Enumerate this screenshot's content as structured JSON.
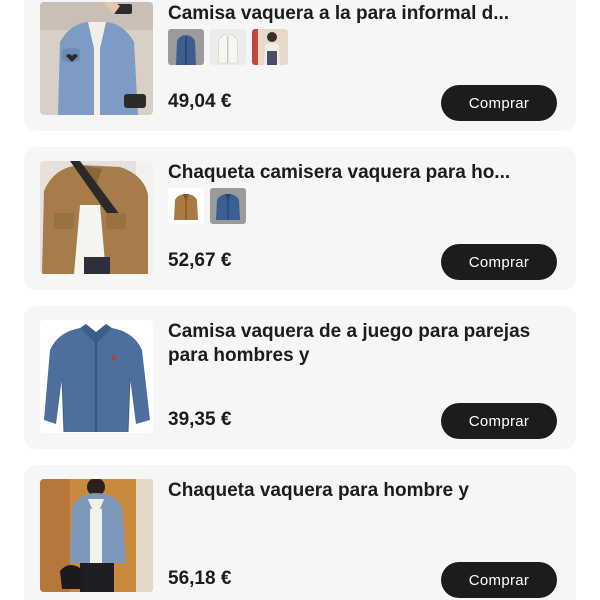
{
  "products": [
    {
      "title": "Camisa vaquera a la para informal d...",
      "price": "49,04 €",
      "button_label": "Comprar",
      "image": "denim-jacket-model-photo",
      "swatches": [
        "blue-denim-swatch",
        "white-denim-swatch",
        "person-photo-swatch"
      ]
    },
    {
      "title": "Chaqueta camisera vaquera para ho...",
      "price": "52,67 €",
      "button_label": "Comprar",
      "image": "brown-corduroy-jacket-photo",
      "swatches": [
        "brown-jacket-swatch",
        "blue-jacket-swatch"
      ]
    },
    {
      "title": "Camisa vaquera de a juego para parejas para hombres y",
      "price": "39,35 €",
      "button_label": "Comprar",
      "image": "denim-shirt-product-photo",
      "swatches": []
    },
    {
      "title": "Chaqueta vaquera para hombre y",
      "price": "56,18 €",
      "button_label": "Comprar",
      "image": "denim-jacket-outfit-photo",
      "swatches": []
    }
  ],
  "colors": {
    "card_background": "#f6f6f6",
    "button_background": "#1c1c1c",
    "button_text": "#ffffff",
    "text": "#1c1c1c"
  }
}
